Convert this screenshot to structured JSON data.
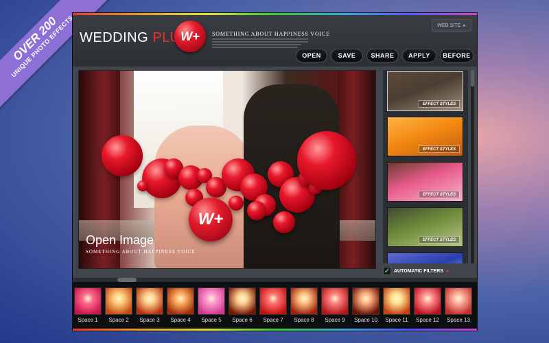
{
  "ribbon": {
    "line1": "OVER 200",
    "line2": "UNIQUE PHOTO EFFECTS"
  },
  "header": {
    "brand_main": "WEDDING",
    "brand_plus": "PLUS",
    "logo_text": "W+",
    "tagline": "SOMETHING ABOUT HAPPINESS VOICE",
    "website_label": "WEB SITE"
  },
  "toolbar": {
    "open": "OPEN",
    "save": "SAVE",
    "share": "SHARE",
    "apply": "APPLY",
    "before": "BEFORE"
  },
  "photo": {
    "logo_text": "W+",
    "open_label": "Open Image",
    "tagline": "SOMETHING ABOUT HAPPINESS VOICE"
  },
  "effects": {
    "button_label": "EFFECT STYLES",
    "items": [
      {
        "colors": [
          "#4a3e32",
          "#a08e78",
          "#5d4a3c"
        ]
      },
      {
        "colors": [
          "#f38a12",
          "#c05a10",
          "#ffb347"
        ]
      },
      {
        "colors": [
          "#e95c8c",
          "#f5b3c9",
          "#6b3b2e"
        ]
      },
      {
        "colors": [
          "#6f8c3a",
          "#b8c48a",
          "#3f4a34"
        ]
      },
      {
        "colors": [
          "#2a3fb0",
          "#c9d3ff",
          "#5b6ad0"
        ]
      }
    ]
  },
  "auto_filters": {
    "label": "AUTOMATIC FILTERS",
    "checked": true,
    "check_glyph": "✓",
    "dot_glyph": "●"
  },
  "filmstrip": [
    {
      "label": "Space 1",
      "colors": [
        "#ff6a8c",
        "#c7144a"
      ]
    },
    {
      "label": "Space 2",
      "colors": [
        "#ffcf7a",
        "#c24a16"
      ]
    },
    {
      "label": "Space 3",
      "colors": [
        "#ffd08a",
        "#b2320f"
      ]
    },
    {
      "label": "Space 4",
      "colors": [
        "#ffb060",
        "#a02a0a"
      ]
    },
    {
      "label": "Space 5",
      "colors": [
        "#ff9ad0",
        "#d03a8e"
      ]
    },
    {
      "label": "Space 6",
      "colors": [
        "#ffd090",
        "#7a1606"
      ]
    },
    {
      "label": "Space 7",
      "colors": [
        "#ff7070",
        "#c01010"
      ]
    },
    {
      "label": "Space 8",
      "colors": [
        "#ffc080",
        "#9a2010"
      ]
    },
    {
      "label": "Space 9",
      "colors": [
        "#ff8080",
        "#b01818"
      ]
    },
    {
      "label": "Space 10",
      "colors": [
        "#ffb080",
        "#6a1208"
      ]
    },
    {
      "label": "Space 11",
      "colors": [
        "#ffe090",
        "#c04010"
      ]
    },
    {
      "label": "Space 12",
      "colors": [
        "#ff9090",
        "#b81020"
      ]
    },
    {
      "label": "Space 13",
      "colors": [
        "#ffb0a0",
        "#c03028"
      ]
    }
  ]
}
